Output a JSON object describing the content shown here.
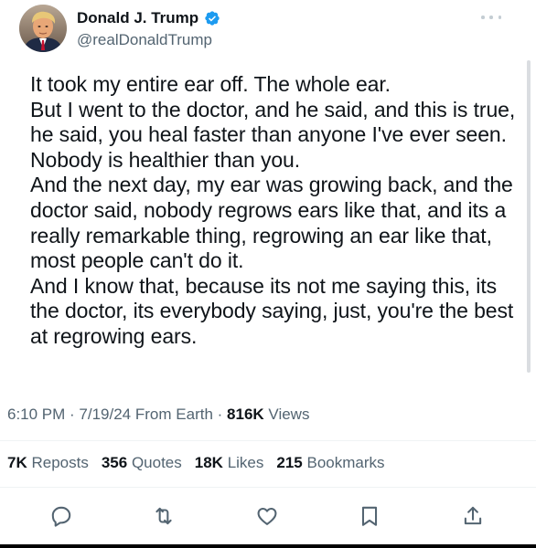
{
  "author": {
    "display_name": "Donald J. Trump",
    "handle": "@realDonaldTrump",
    "verified_icon": "verified-badge-icon",
    "avatar_icon": "avatar-photo"
  },
  "more_icon": "more-options-icon",
  "tweet": {
    "paragraphs": [
      "It took my entire ear off. The whole ear.",
      "But I went to the doctor, and he said, and this is true, he said, you heal faster than anyone I've ever seen. Nobody is healthier than you.",
      "And the next day, my ear was growing back, and the doctor said, nobody regrows ears like that, and its a really remarkable thing, regrowing an ear like that, most people can't do it.",
      "And I know that, because its not me saying this, its the doctor, its everybody saying, just, you're the best at regrowing ears."
    ]
  },
  "meta": {
    "time": "6:10 PM",
    "separator": " · ",
    "date": "7/19/24",
    "source": "From Earth",
    "views_count": "816K",
    "views_label": "Views"
  },
  "stats": {
    "reposts_count": "7K",
    "reposts_label": "Reposts",
    "quotes_count": "356",
    "quotes_label": "Quotes",
    "likes_count": "18K",
    "likes_label": "Likes",
    "bookmarks_count": "215",
    "bookmarks_label": "Bookmarks"
  },
  "actions": [
    {
      "icon": "reply-icon"
    },
    {
      "icon": "repost-icon"
    },
    {
      "icon": "like-icon"
    },
    {
      "icon": "bookmark-icon"
    },
    {
      "icon": "share-icon"
    }
  ],
  "colors": {
    "primary_text": "#0f1419",
    "secondary_text": "#536471",
    "verified_blue": "#1d9bf0",
    "divider": "#eff3f4"
  }
}
